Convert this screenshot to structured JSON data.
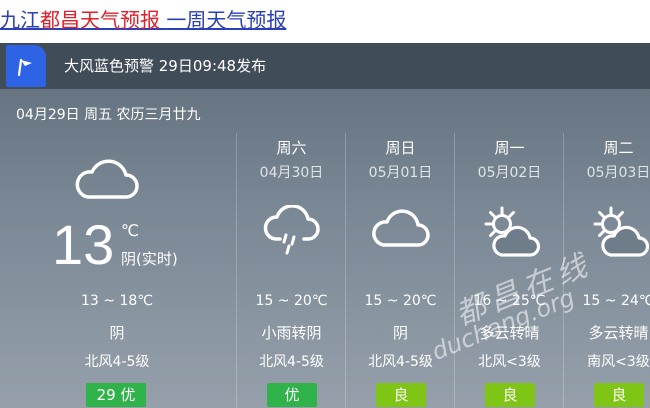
{
  "header": {
    "city_prefix": "九江",
    "city_name": "都昌",
    "page_label": "天气预报",
    "spacer": " ",
    "weekly_link": "一周天气预报"
  },
  "alert": {
    "icon": "flag-icon",
    "text": "大风蓝色预警 29日09:48发布",
    "icon_bg": "#2f63e6"
  },
  "today": {
    "date_line": "04月29日 周五 农历三月廿九",
    "icon": "cloud-icon",
    "temp_now": "13",
    "unit": "℃",
    "condition_now": "阴(实时)",
    "range": "13 ~ 18℃",
    "condition": "阴",
    "wind": "北风4-5级",
    "aqi_value": "29",
    "aqi_label": "优",
    "aqi_text": "29  优"
  },
  "forecast": [
    {
      "weekday": "周六",
      "date": "04月30日",
      "icon": "cloud-rain-icon",
      "range": "15 ~ 20℃",
      "condition": "小雨转阴",
      "wind": "北风4-5级",
      "aqi": "优"
    },
    {
      "weekday": "周日",
      "date": "05月01日",
      "icon": "cloud-icon",
      "range": "15 ~ 20℃",
      "condition": "阴",
      "wind": "北风4-5级",
      "aqi": "良"
    },
    {
      "weekday": "周一",
      "date": "05月02日",
      "icon": "sun-cloud-icon",
      "range": "16 ~ 25℃",
      "condition": "多云转晴",
      "wind": "北风<3级",
      "aqi": "良"
    },
    {
      "weekday": "周二",
      "date": "05月03日",
      "icon": "sun-cloud-icon",
      "range": "15 ~ 24℃",
      "condition": "多云转晴",
      "wind": "南风<3级",
      "aqi": "良"
    }
  ],
  "colors": {
    "aqi_excellent": "#2fb34a",
    "aqi_good": "#7ec515",
    "title_blue": "#2a3fb8",
    "title_red": "#e0202a"
  },
  "watermark": {
    "cn": "都昌在线",
    "en": "duchang.org"
  }
}
